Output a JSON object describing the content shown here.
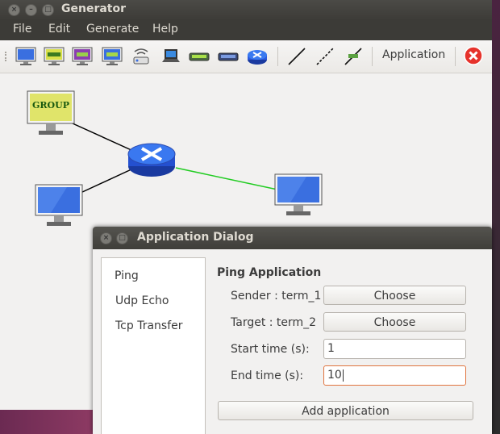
{
  "window": {
    "title": "Generator"
  },
  "menu": [
    "File",
    "Edit",
    "Generate",
    "Help"
  ],
  "toolbar": {
    "icons": [
      "terminal-icon",
      "group-icon",
      "emulated-terminal-icon",
      "terminal-group-icon",
      "access-point-icon",
      "laptop-icon",
      "hub-icon",
      "switch-icon",
      "router-icon",
      "wired-link-icon",
      "wireless-link-icon",
      "delete-link-icon"
    ],
    "application_label": "Application",
    "close_color": "#e6322b"
  },
  "canvas": {
    "nodes": [
      {
        "type": "group",
        "label": "GROUP"
      },
      {
        "type": "router"
      },
      {
        "type": "terminal"
      },
      {
        "type": "terminal"
      }
    ],
    "link_colors": {
      "wired": "#000000",
      "wireless": "#22cc22"
    }
  },
  "dialog": {
    "title": "Application Dialog",
    "apps": [
      "Ping",
      "Udp Echo",
      "Tcp Transfer"
    ],
    "selected_app": "Ping",
    "section_title": "Ping Application",
    "sender_label": "Sender : term_1",
    "target_label": "Target : term_2",
    "choose_label": "Choose",
    "start_label": "Start time (s):",
    "start_value": "1",
    "end_label": "End time (s):",
    "end_value": "10",
    "add_label": "Add application",
    "focus_color": "#e0743f"
  }
}
